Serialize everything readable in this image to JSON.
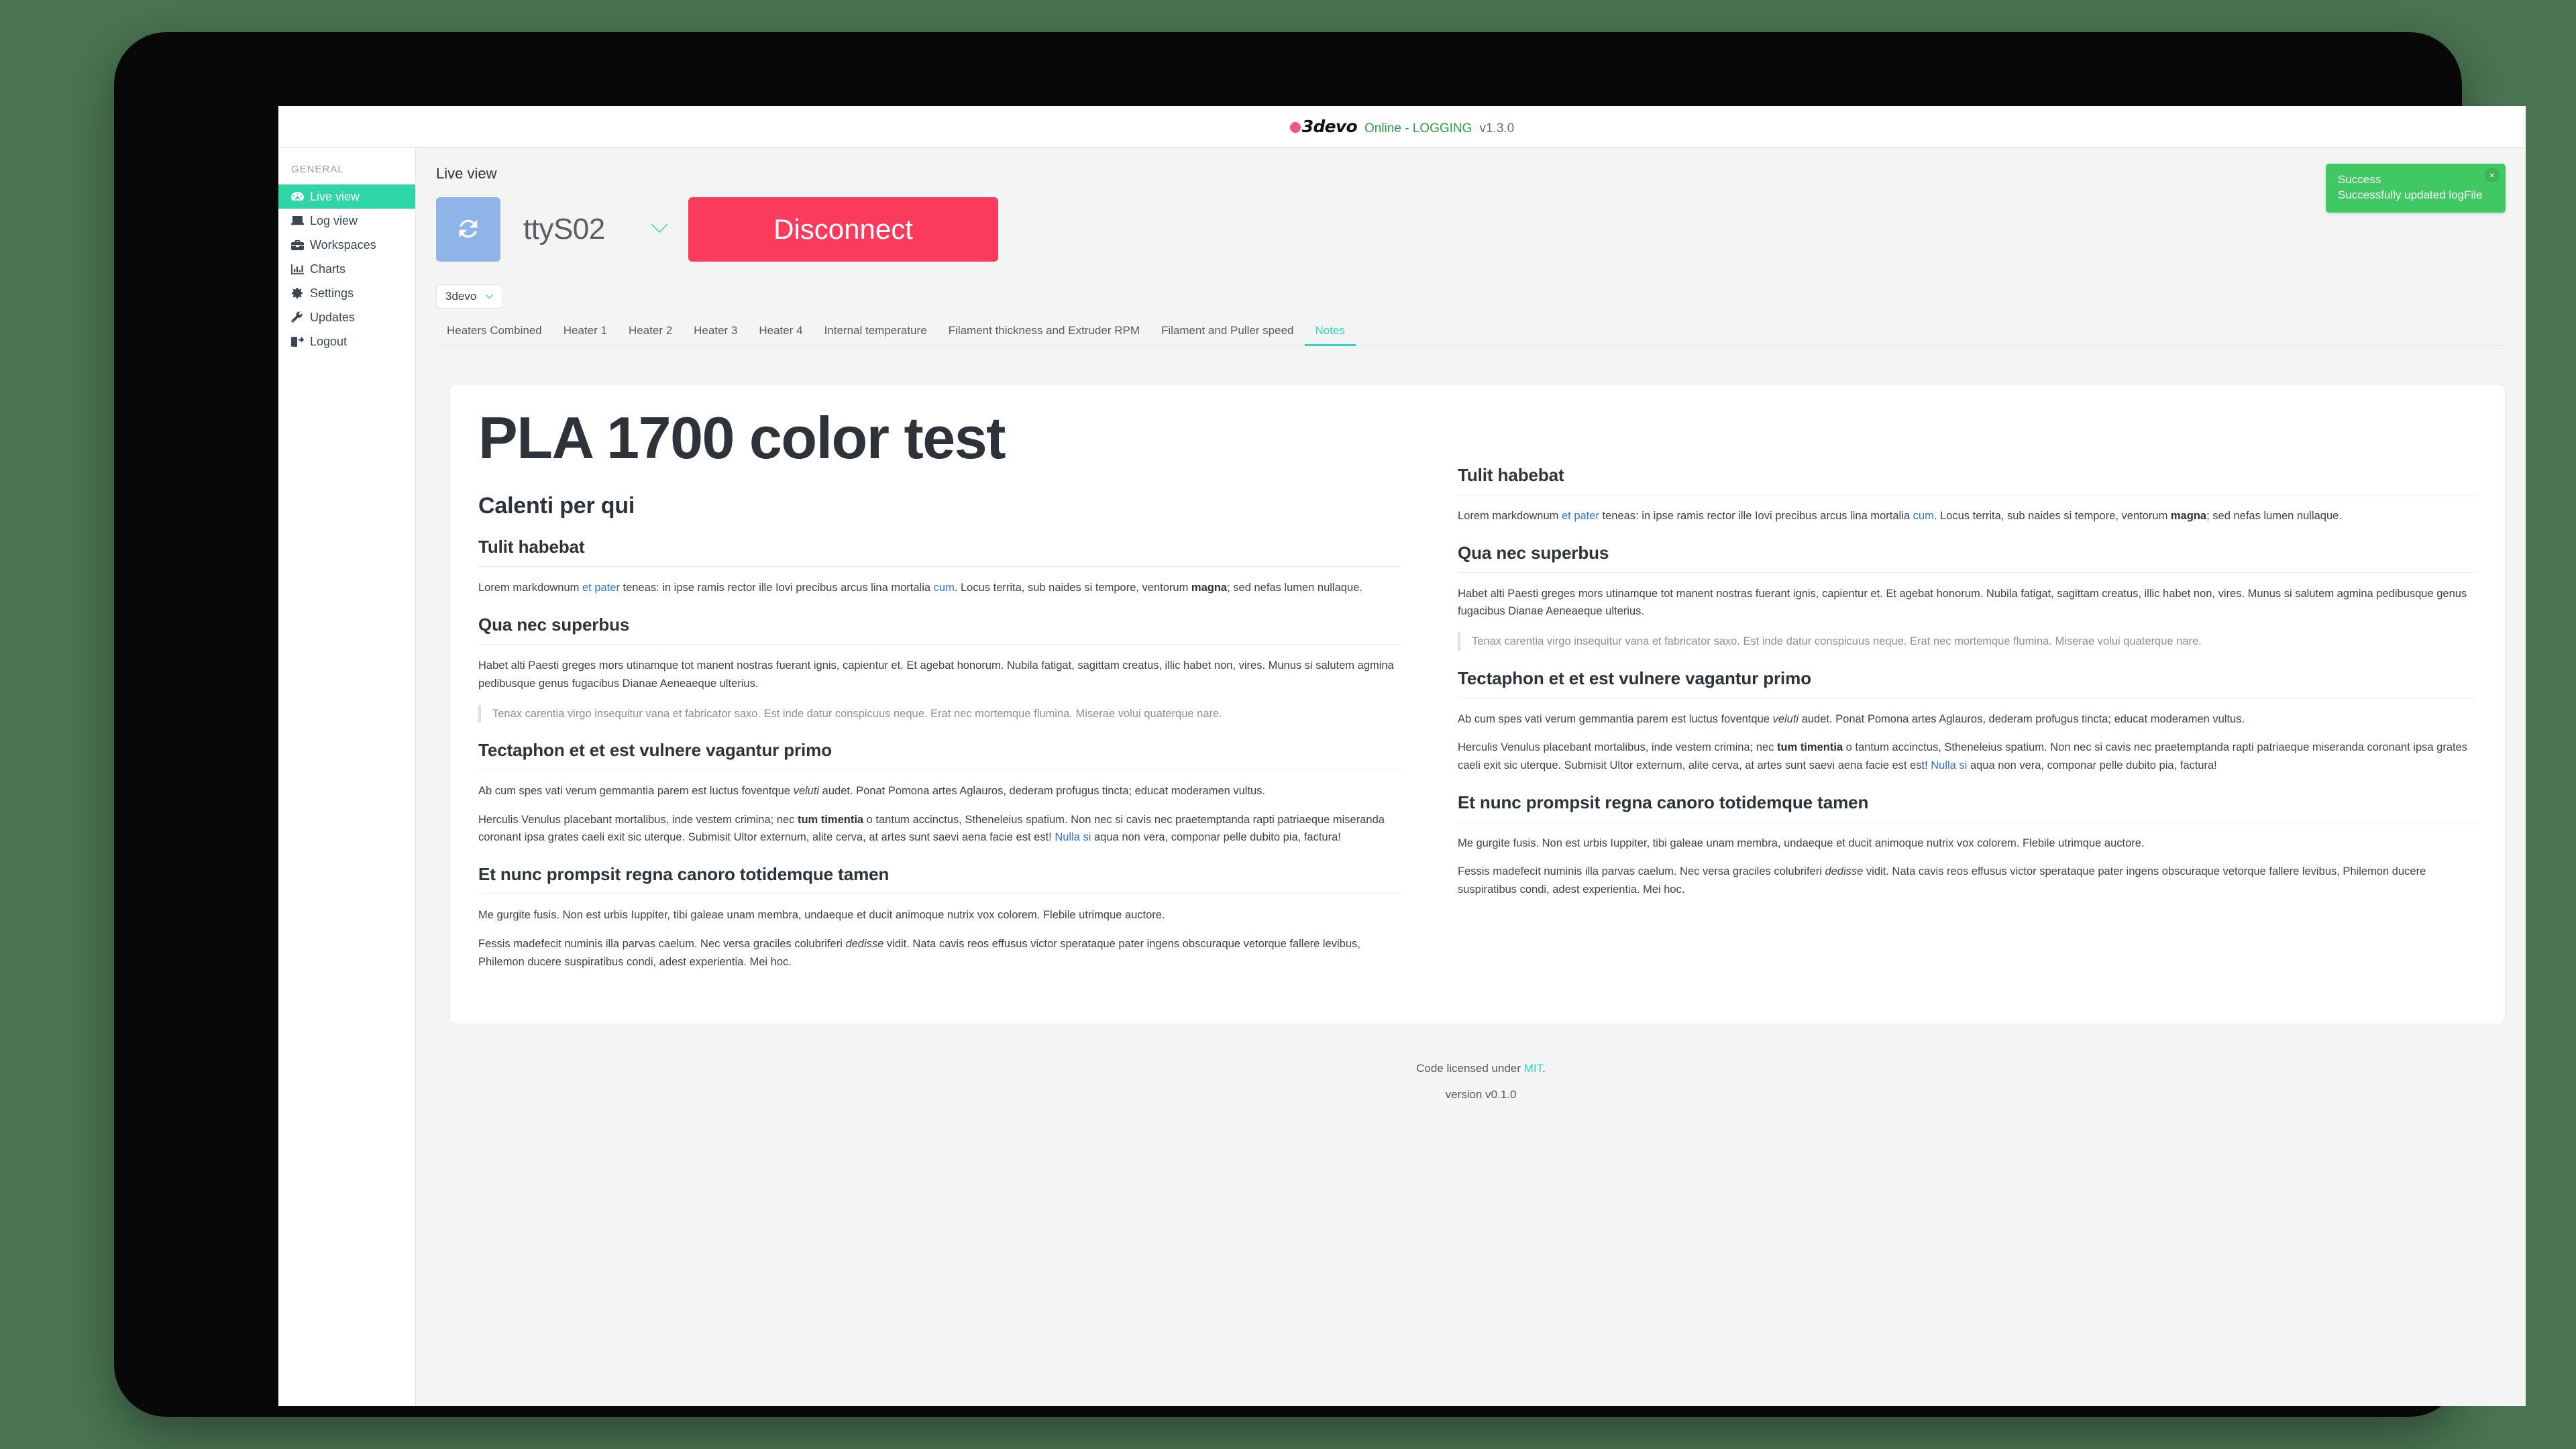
{
  "titlebar": {
    "brand": "3devo",
    "status": "Online - LOGGING",
    "version": "v1.3.0",
    "logo_dot_color": "#f9547b",
    "status_color": "#2f9b45"
  },
  "sidebar": {
    "heading": "GENERAL",
    "items": [
      {
        "label": "Live view",
        "icon": "dashboard-icon",
        "active": true
      },
      {
        "label": "Log view",
        "icon": "laptop-icon",
        "active": false
      },
      {
        "label": "Workspaces",
        "icon": "briefcase-icon",
        "active": false
      },
      {
        "label": "Charts",
        "icon": "bar-chart-icon",
        "active": false
      },
      {
        "label": "Settings",
        "icon": "gear-icon",
        "active": false
      },
      {
        "label": "Updates",
        "icon": "wrench-icon",
        "active": false
      },
      {
        "label": "Logout",
        "icon": "sign-out-icon",
        "active": false
      }
    ],
    "active_color": "#2fd6a5"
  },
  "main": {
    "page_title": "Live view",
    "refresh_label": "refresh-icon",
    "port_value": "ttyS02",
    "disconnect_label": "Disconnect",
    "disconnect_color": "#fb3b5c",
    "workspace_value": "3devo"
  },
  "tabs": [
    {
      "label": "Heaters Combined",
      "active": false
    },
    {
      "label": "Heater 1",
      "active": false
    },
    {
      "label": "Heater 2",
      "active": false
    },
    {
      "label": "Heater 3",
      "active": false
    },
    {
      "label": "Heater 4",
      "active": false
    },
    {
      "label": "Internal temperature",
      "active": false
    },
    {
      "label": "Filament thickness and Extruder RPM",
      "active": false
    },
    {
      "label": "Filament and Puller speed",
      "active": false
    },
    {
      "label": "Notes",
      "active": true
    }
  ],
  "notes": {
    "h1": "PLA 1700 color test",
    "h2": "Calenti per qui",
    "sec1_heading": "Tulit habebat",
    "sec1_p1_a": "Lorem markdownum ",
    "sec1_p1_link1": "et pater",
    "sec1_p1_b": " teneas: in ipse ramis rector ille Iovi precibus arcus lina mortalia ",
    "sec1_p1_link2": "cum",
    "sec1_p1_c": ". Locus territa, sub naides si tempore, ventorum ",
    "sec1_p1_bold": "magna",
    "sec1_p1_d": "; sed nefas lumen nullaque.",
    "sec2_heading": "Qua nec superbus",
    "sec2_p1": "Habet alti Paesti greges mors utinamque tot manent nostras fuerant ignis, capientur et. Et agebat honorum. Nubila fatigat, sagittam creatus, illic habet non, vires. Munus si salutem agmina pedibusque genus fugacibus Dianae Aeneaeque ulterius.",
    "sec2_quote": "Tenax carentia virgo insequitur vana et fabricator saxo. Est inde datur conspicuus neque. Erat nec mortemque flumina. Miserae volui quaterque nare.",
    "sec3_heading": "Tectaphon et et est vulnere vagantur primo",
    "sec3_p1_a": "Ab cum spes vati verum gemmantia parem est luctus foventque ",
    "sec3_p1_i": "veluti",
    "sec3_p1_b": " audet. Ponat Pomona artes Aglauros, dederam profugus tincta; educat moderamen vultus.",
    "sec3_p2_a": "Herculis Venulus placebant mortalibus, inde vestem crimina; nec ",
    "sec3_p2_bold": "tum timentia",
    "sec3_p2_b": " o tantum accinctus, Stheneleius spatium. Non nec si cavis nec praetemptanda rapti patriaeque miseranda coronant ipsa grates caeli exit sic uterque. Submisit Ultor externum, alite cerva, at artes sunt saevi aena facie est est! ",
    "sec3_p2_link": "Nulla si",
    "sec3_p2_c": " aqua non vera, componar pelle dubito pia, factura!",
    "sec4_heading": "Et nunc prompsit regna canoro totidemque tamen",
    "sec4_p1": "Me gurgite fusis. Non est urbis Iuppiter, tibi galeae unam membra, undaeque et ducit animoque nutrix vox colorem. Flebile utrimque auctore.",
    "sec4_p2_a": "Fessis madefecit numinis illa parvas caelum. Nec versa graciles colubriferi ",
    "sec4_p2_i": "dedisse",
    "sec4_p2_b": " vidit. Nata cavis reos effusus victor sperataque pater ingens obscuraque vetorque fallere levibus, Philemon ducere suspiratibus condi, adest experientia. Mei hoc."
  },
  "footer": {
    "license_prefix": "Code licensed under ",
    "license_link": "MIT",
    "license_suffix": ".",
    "version": "version v0.1.0"
  },
  "toast": {
    "title": "Success",
    "message": "Successfully updated logFile",
    "close": "×",
    "color": "#40c962"
  }
}
